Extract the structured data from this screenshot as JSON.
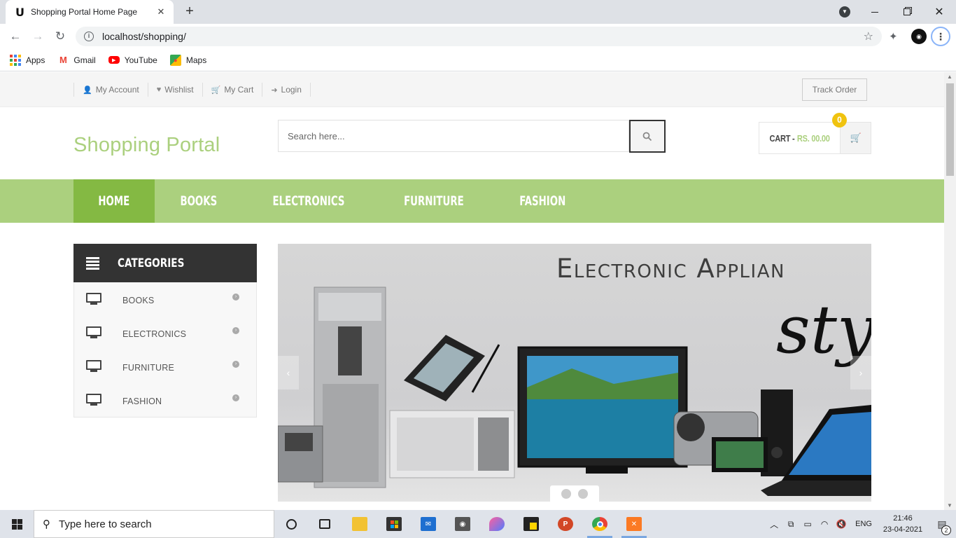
{
  "browser": {
    "tab_title": "Shopping Portal Home Page",
    "tab_close": "✕",
    "new_tab": "+",
    "url": "localhost/shopping/",
    "bookmarks": [
      {
        "label": "Apps"
      },
      {
        "label": "Gmail"
      },
      {
        "label": "YouTube"
      },
      {
        "label": "Maps"
      }
    ]
  },
  "topbar": {
    "links": [
      {
        "icon": "user-icon",
        "glyph": "👤",
        "label": "My Account"
      },
      {
        "icon": "heart-icon",
        "glyph": "♥",
        "label": "Wishlist"
      },
      {
        "icon": "cart-icon",
        "glyph": "🛒",
        "label": "My Cart"
      },
      {
        "icon": "login-icon",
        "glyph": "➜",
        "label": "Login"
      }
    ],
    "track_order": "Track Order"
  },
  "header": {
    "logo": "Shopping Portal",
    "search_placeholder": "Search here...",
    "cart_label": "CART -",
    "cart_price": "RS. 00.00",
    "cart_count": "0"
  },
  "nav": {
    "items": [
      {
        "label": "HOME",
        "active": true
      },
      {
        "label": "BOOKS",
        "active": false
      },
      {
        "label": "ELECTRONICS",
        "active": false
      },
      {
        "label": "FURNITURE",
        "active": false
      },
      {
        "label": "FASHION",
        "active": false
      }
    ]
  },
  "categories": {
    "title": "CATEGORIES",
    "items": [
      {
        "label": "BOOKS"
      },
      {
        "label": "ELECTRONICS"
      },
      {
        "label": "FURNITURE"
      },
      {
        "label": "FASHION"
      }
    ]
  },
  "slider": {
    "title": "Electronic Applian",
    "script": "sty",
    "dots": 2
  },
  "taskbar": {
    "search_text": "Type here to search",
    "language": "ENG",
    "time": "21:46",
    "date": "23-04-2021",
    "notifications": "2"
  },
  "colors": {
    "brand_green": "#abd07e",
    "nav_active": "#84b943",
    "category_header": "#333333",
    "cart_badge": "#f0c30f"
  }
}
